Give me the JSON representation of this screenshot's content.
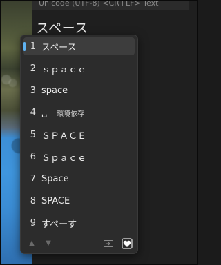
{
  "statusbar": {
    "text": "Unicode (UTF-8)  <CR+LF>  Text"
  },
  "editor": {
    "typed_text": "スペース"
  },
  "candidates": [
    {
      "num": "1",
      "text": "スペース",
      "note": ""
    },
    {
      "num": "2",
      "text": "ｓｐａｃｅ",
      "note": ""
    },
    {
      "num": "3",
      "text": "space",
      "note": ""
    },
    {
      "num": "4",
      "text": "␣",
      "note": "環境依存"
    },
    {
      "num": "5",
      "text": "ＳＰＡＣＥ",
      "note": ""
    },
    {
      "num": "6",
      "text": "Ｓｐａｃｅ",
      "note": ""
    },
    {
      "num": "7",
      "text": "Space",
      "note": ""
    },
    {
      "num": "8",
      "text": "SPACE",
      "note": ""
    },
    {
      "num": "9",
      "text": "すぺーす",
      "note": ""
    }
  ],
  "selected_index": 0,
  "footer": {
    "prev_icon": "triangle-up-icon",
    "next_icon": "triangle-down-icon",
    "expand_icon": "expand-table-icon",
    "favorite_icon": "heart-icon"
  },
  "colors": {
    "accent": "#5fb2f2",
    "popup_bg": "#2c2c2c",
    "selected_bg": "#3d3d3d"
  }
}
